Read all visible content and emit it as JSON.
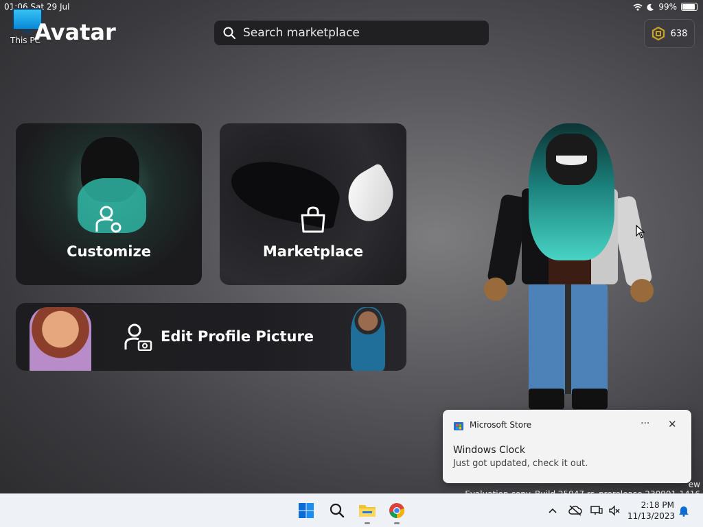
{
  "status_bar": {
    "time_date": "01:06   Sat 29 Jul",
    "battery": "99%"
  },
  "desktop": {
    "icon_label": "This PC"
  },
  "header": {
    "title": "Avatar",
    "search_placeholder": "Search marketplace",
    "robux_balance": "638"
  },
  "cards": {
    "customize": "Customize",
    "marketplace": "Marketplace",
    "edit_profile": "Edit Profile Picture"
  },
  "notification": {
    "app": "Microsoft Store",
    "more": "···",
    "close": "✕",
    "title": "Windows Clock",
    "body": "Just got updated, check it out."
  },
  "watermark": {
    "line1": "ew",
    "line2": "Evaluation copy. Build 25947.rs_prerelease.230901-1416"
  },
  "taskbar": {
    "time": "2:18 PM",
    "date": "11/13/2023"
  },
  "colors": {
    "accent_blue": "#0a6cd6",
    "robux_gold": "#c9a227",
    "teal_hair": "#2fb5a5"
  }
}
